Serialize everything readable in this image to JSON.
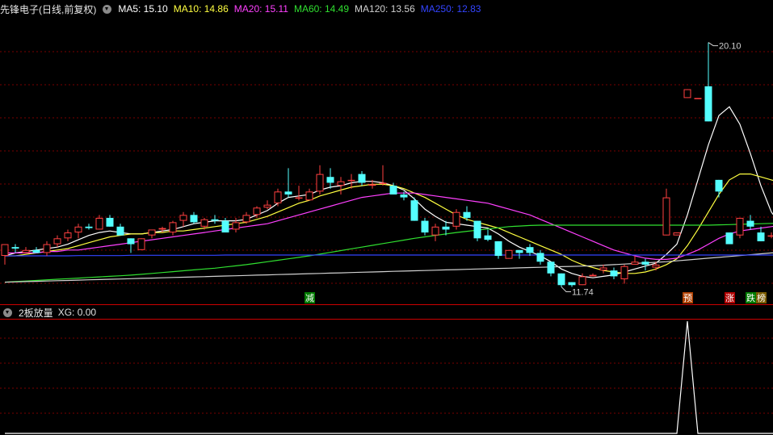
{
  "main_panel": {
    "stock_title": "先锋电子(日线,前复权)",
    "indicators": [
      {
        "label": "MA5:",
        "value": "15.10",
        "color": "#ffffff"
      },
      {
        "label": "MA10:",
        "value": "14.86",
        "color": "#ffff40"
      },
      {
        "label": "MA20:",
        "value": "15.11",
        "color": "#ff40ff"
      },
      {
        "label": "MA60:",
        "value": "14.49",
        "color": "#30e030"
      },
      {
        "label": "MA120:",
        "value": "13.56",
        "color": "#d0d0d0"
      },
      {
        "label": "MA250:",
        "value": "12.83",
        "color": "#3344ff"
      }
    ]
  },
  "sub_panel": {
    "indicator_name": "2板放量",
    "indicators": [
      {
        "label": "XG:",
        "value": "0.00",
        "color": "#e0e0e0"
      }
    ]
  },
  "colors": {
    "up": "#ff4040",
    "down": "#54ffff",
    "grid": "#7a0000",
    "border": "#cc0000",
    "ma5": "#ffffff",
    "ma10": "#ffff40",
    "ma20": "#ff40ff",
    "ma60": "#30e030",
    "ma120": "#d0d0d0",
    "ma250": "#3344ff"
  },
  "chart_data": [
    {
      "type": "candlestick",
      "title": "先锋电子(日线,前复权)",
      "ylim": [
        11.2,
        21.0
      ],
      "ohlc": [
        [
          12.8,
          13.2,
          12.5,
          13.2
        ],
        [
          13.1,
          13.2,
          12.9,
          13.05
        ],
        [
          12.9,
          13.1,
          12.9,
          13.0
        ],
        [
          13.0,
          13.1,
          12.9,
          12.9
        ],
        [
          12.9,
          13.3,
          12.8,
          13.2
        ],
        [
          13.2,
          13.5,
          13.1,
          13.4
        ],
        [
          13.4,
          13.7,
          13.3,
          13.6
        ],
        [
          13.6,
          13.9,
          13.4,
          13.8
        ],
        [
          13.8,
          13.9,
          13.7,
          13.75
        ],
        [
          13.7,
          14.2,
          13.7,
          14.1
        ],
        [
          14.1,
          14.2,
          13.8,
          13.8
        ],
        [
          13.8,
          13.9,
          13.5,
          13.5
        ],
        [
          13.4,
          13.4,
          12.9,
          13.2
        ],
        [
          13.0,
          13.4,
          13.0,
          13.4
        ],
        [
          13.5,
          13.7,
          13.4,
          13.7
        ],
        [
          13.7,
          13.8,
          13.6,
          13.75
        ],
        [
          13.6,
          14.0,
          13.5,
          13.95
        ],
        [
          14.0,
          14.3,
          13.8,
          14.2
        ],
        [
          14.2,
          14.3,
          13.9,
          13.95
        ],
        [
          13.8,
          14.1,
          13.7,
          14.05
        ],
        [
          14.05,
          14.2,
          13.9,
          14.0
        ],
        [
          14.0,
          14.1,
          13.6,
          13.6
        ],
        [
          13.7,
          14.1,
          13.6,
          13.95
        ],
        [
          13.95,
          14.3,
          13.9,
          14.2
        ],
        [
          14.2,
          14.5,
          14.1,
          14.45
        ],
        [
          14.45,
          14.7,
          14.4,
          14.55
        ],
        [
          14.6,
          15.1,
          14.5,
          15.0
        ],
        [
          15.0,
          15.8,
          14.8,
          14.9
        ],
        [
          14.8,
          15.2,
          14.7,
          14.8
        ],
        [
          14.7,
          15.1,
          14.7,
          15.0
        ],
        [
          15.0,
          15.9,
          14.9,
          15.6
        ],
        [
          15.5,
          15.8,
          15.1,
          15.3
        ],
        [
          15.2,
          15.5,
          14.9,
          15.35
        ],
        [
          15.4,
          15.6,
          15.1,
          15.4
        ],
        [
          15.6,
          15.7,
          15.2,
          15.3
        ],
        [
          15.2,
          15.4,
          15.1,
          15.25
        ],
        [
          15.3,
          15.9,
          15.2,
          15.3
        ],
        [
          15.2,
          15.3,
          14.9,
          14.9
        ],
        [
          14.9,
          15.0,
          14.7,
          14.8
        ],
        [
          14.7,
          14.8,
          14.0,
          14.0
        ],
        [
          14.0,
          14.1,
          13.5,
          13.6
        ],
        [
          13.5,
          13.9,
          13.3,
          13.8
        ],
        [
          13.8,
          14.0,
          13.5,
          13.7
        ],
        [
          13.8,
          14.4,
          13.7,
          14.3
        ],
        [
          14.3,
          14.5,
          14.0,
          14.1
        ],
        [
          14.0,
          14.0,
          13.3,
          13.4
        ],
        [
          13.5,
          13.7,
          13.3,
          13.35
        ],
        [
          13.3,
          13.3,
          12.7,
          12.8
        ],
        [
          12.7,
          13.0,
          12.7,
          13.0
        ],
        [
          13.0,
          13.0,
          12.7,
          12.9
        ],
        [
          13.1,
          13.2,
          12.8,
          12.9
        ],
        [
          12.9,
          13.0,
          12.5,
          12.6
        ],
        [
          12.6,
          12.6,
          12.1,
          12.2
        ],
        [
          12.2,
          12.2,
          11.74,
          11.8
        ],
        [
          11.9,
          11.9,
          11.74,
          11.8
        ],
        [
          11.8,
          12.2,
          11.8,
          12.1
        ],
        [
          12.1,
          12.2,
          12.1,
          12.15
        ],
        [
          12.3,
          12.5,
          12.2,
          12.4
        ],
        [
          12.3,
          12.4,
          12.0,
          12.1
        ],
        [
          12.0,
          12.5,
          11.85,
          12.45
        ],
        [
          12.5,
          12.8,
          12.5,
          12.6
        ],
        [
          12.6,
          12.7,
          12.3,
          12.5
        ],
        [
          12.4,
          12.6,
          12.3,
          12.5
        ],
        [
          13.5,
          15.1,
          13.5,
          14.8
        ],
        [
          13.5,
          13.6,
          13.5,
          13.6
        ],
        [
          18.2,
          18.5,
          18.2,
          18.5
        ],
        [
          18.2,
          18.2,
          18.2,
          18.2
        ],
        [
          18.6,
          20.1,
          17.4,
          17.4
        ],
        [
          15.4,
          15.4,
          14.8,
          15.0
        ],
        [
          13.6,
          13.6,
          13.2,
          13.2
        ],
        [
          13.5,
          14.1,
          13.4,
          14.1
        ],
        [
          14.0,
          14.2,
          13.7,
          13.8
        ],
        [
          13.6,
          13.8,
          13.3,
          13.3
        ],
        [
          13.5,
          13.6,
          13.4,
          13.5
        ],
        [
          13.6,
          13.9,
          13.5,
          13.8
        ],
        [
          13.8,
          14.0,
          13.7,
          13.9
        ],
        [
          13.8,
          14.1,
          13.8,
          14.05
        ],
        [
          13.9,
          14.3,
          13.9,
          14.25
        ],
        [
          14.0,
          14.4,
          13.9,
          14.2
        ]
      ],
      "max_label": "20.10",
      "min_label": "11.74",
      "signals": [
        {
          "bar": 29,
          "text": "减",
          "bg": "#007a00"
        },
        {
          "bar": 65,
          "text": "预",
          "bg": "#b04000"
        },
        {
          "bar": 69,
          "text": "涨",
          "bg": "#b00000"
        },
        {
          "bar": 71,
          "text": "跌",
          "bg": "#007a00"
        },
        {
          "bar": 72,
          "text": "榜",
          "bg": "#7a5a00"
        }
      ],
      "ma_series": [
        {
          "name": "MA5",
          "color": "#ffffff",
          "values": [
            12.8,
            12.9,
            12.95,
            13.0,
            13.05,
            13.1,
            13.2,
            13.35,
            13.5,
            13.6,
            13.65,
            13.6,
            13.55,
            13.55,
            13.6,
            13.65,
            13.7,
            13.8,
            13.9,
            13.95,
            14.0,
            14.0,
            14.0,
            14.05,
            14.2,
            14.35,
            14.6,
            14.8,
            14.85,
            14.9,
            15.05,
            15.15,
            15.2,
            15.3,
            15.35,
            15.35,
            15.3,
            15.2,
            15.05,
            14.75,
            14.4,
            14.15,
            13.95,
            13.9,
            13.85,
            13.8,
            13.75,
            13.55,
            13.3,
            13.1,
            12.95,
            12.8,
            12.6,
            12.35,
            12.2,
            12.1,
            12.05,
            12.1,
            12.15,
            12.25,
            12.35,
            12.45,
            12.55,
            12.85,
            13.2,
            14.2,
            15.4,
            16.6,
            17.6,
            17.9,
            17.3,
            16.3,
            15.2,
            14.3,
            13.8,
            13.6,
            13.65,
            13.75,
            13.9,
            14.0
          ]
        },
        {
          "name": "MA10",
          "color": "#ffff40",
          "values": [
            12.8,
            12.8,
            12.85,
            12.9,
            12.95,
            13.0,
            13.05,
            13.15,
            13.25,
            13.35,
            13.45,
            13.5,
            13.55,
            13.55,
            13.6,
            13.6,
            13.65,
            13.65,
            13.7,
            13.75,
            13.8,
            13.85,
            13.9,
            13.95,
            14.05,
            14.15,
            14.3,
            14.45,
            14.6,
            14.7,
            14.85,
            14.95,
            15.05,
            15.15,
            15.2,
            15.25,
            15.25,
            15.2,
            15.1,
            14.95,
            14.8,
            14.6,
            14.4,
            14.2,
            14.05,
            13.95,
            13.85,
            13.75,
            13.6,
            13.45,
            13.3,
            13.15,
            13.0,
            12.85,
            12.65,
            12.5,
            12.4,
            12.3,
            12.25,
            12.2,
            12.2,
            12.25,
            12.35,
            12.5,
            12.7,
            13.15,
            13.7,
            14.3,
            14.9,
            15.4,
            15.6,
            15.6,
            15.5,
            15.4,
            15.3,
            15.2,
            15.15,
            15.1,
            15.1,
            15.1
          ]
        },
        {
          "name": "MA20",
          "color": "#ff40ff",
          "values": [
            12.9,
            12.9,
            12.9,
            12.9,
            12.95,
            12.95,
            13.0,
            13.0,
            13.05,
            13.1,
            13.15,
            13.2,
            13.25,
            13.3,
            13.35,
            13.4,
            13.45,
            13.5,
            13.55,
            13.6,
            13.65,
            13.7,
            13.75,
            13.8,
            13.85,
            13.9,
            14.0,
            14.1,
            14.2,
            14.3,
            14.4,
            14.5,
            14.6,
            14.7,
            14.8,
            14.85,
            14.9,
            14.95,
            14.95,
            14.95,
            14.9,
            14.85,
            14.8,
            14.75,
            14.7,
            14.65,
            14.6,
            14.5,
            14.4,
            14.3,
            14.2,
            14.05,
            13.9,
            13.75,
            13.6,
            13.45,
            13.3,
            13.15,
            13.0,
            12.9,
            12.8,
            12.72,
            12.68,
            12.68,
            12.72,
            12.85,
            13.0,
            13.2,
            13.4,
            13.55,
            13.65,
            13.7,
            13.75,
            13.8,
            13.85,
            13.9,
            13.95,
            14.0,
            14.05,
            14.1
          ]
        },
        {
          "name": "MA60",
          "color": "#30e030",
          "values": [
            11.9,
            11.92,
            11.94,
            11.96,
            11.98,
            12.0,
            12.02,
            12.04,
            12.06,
            12.08,
            12.1,
            12.12,
            12.14,
            12.17,
            12.2,
            12.23,
            12.26,
            12.29,
            12.32,
            12.35,
            12.38,
            12.42,
            12.46,
            12.5,
            12.55,
            12.6,
            12.65,
            12.7,
            12.75,
            12.8,
            12.86,
            12.92,
            12.98,
            13.04,
            13.1,
            13.16,
            13.22,
            13.28,
            13.34,
            13.4,
            13.45,
            13.5,
            13.55,
            13.6,
            13.64,
            13.68,
            13.72,
            13.76,
            13.8,
            13.82,
            13.84,
            13.85,
            13.85,
            13.85,
            13.85,
            13.85,
            13.85,
            13.85,
            13.85,
            13.85,
            13.85,
            13.85,
            13.85,
            13.85,
            13.85,
            13.85,
            13.85,
            13.85,
            13.86,
            13.87,
            13.88,
            13.89,
            13.9,
            13.91,
            13.92,
            13.93,
            13.94,
            13.95,
            13.96,
            13.97
          ]
        },
        {
          "name": "MA120",
          "color": "#d0d0d0",
          "values": [
            11.9,
            11.91,
            11.92,
            11.93,
            11.94,
            11.95,
            11.96,
            11.97,
            11.98,
            11.99,
            12.0,
            12.01,
            12.02,
            12.03,
            12.04,
            12.05,
            12.06,
            12.07,
            12.08,
            12.09,
            12.1,
            12.11,
            12.12,
            12.13,
            12.14,
            12.15,
            12.16,
            12.17,
            12.18,
            12.19,
            12.2,
            12.21,
            12.22,
            12.23,
            12.24,
            12.25,
            12.26,
            12.27,
            12.28,
            12.29,
            12.3,
            12.31,
            12.32,
            12.33,
            12.34,
            12.35,
            12.36,
            12.37,
            12.38,
            12.39,
            12.4,
            12.41,
            12.42,
            12.43,
            12.44,
            12.45,
            12.46,
            12.48,
            12.5,
            12.52,
            12.54,
            12.56,
            12.58,
            12.6,
            12.63,
            12.66,
            12.69,
            12.72,
            12.75,
            12.78,
            12.81,
            12.84,
            12.87,
            12.9,
            12.93,
            12.96,
            12.99,
            13.02,
            13.05,
            13.08
          ]
        },
        {
          "name": "MA250",
          "color": "#3344ff",
          "values": [
            12.8,
            12.8,
            12.8,
            12.8,
            12.8,
            12.8,
            12.8,
            12.81,
            12.81,
            12.81,
            12.81,
            12.81,
            12.82,
            12.82,
            12.82,
            12.82,
            12.82,
            12.82,
            12.82,
            12.82,
            12.82,
            12.83,
            12.83,
            12.83,
            12.83,
            12.83,
            12.83,
            12.83,
            12.83,
            12.83,
            12.83,
            12.83,
            12.83,
            12.83,
            12.83,
            12.83,
            12.83,
            12.83,
            12.83,
            12.83,
            12.83,
            12.83,
            12.83,
            12.83,
            12.83,
            12.83,
            12.83,
            12.83,
            12.83,
            12.83,
            12.83,
            12.83,
            12.83,
            12.83,
            12.83,
            12.83,
            12.83,
            12.83,
            12.83,
            12.83,
            12.83,
            12.83,
            12.83,
            12.83,
            12.83,
            12.83,
            12.83,
            12.83,
            12.83,
            12.83,
            12.83,
            12.83,
            12.83,
            12.83,
            12.83,
            12.83,
            12.83,
            12.83,
            12.83,
            12.83
          ]
        }
      ]
    },
    {
      "type": "line",
      "title": "2板放量",
      "ylim": [
        0,
        1
      ],
      "series": [
        {
          "name": "XG",
          "values": [
            0,
            0,
            0,
            0,
            0,
            0,
            0,
            0,
            0,
            0,
            0,
            0,
            0,
            0,
            0,
            0,
            0,
            0,
            0,
            0,
            0,
            0,
            0,
            0,
            0,
            0,
            0,
            0,
            0,
            0,
            0,
            0,
            0,
            0,
            0,
            0,
            0,
            0,
            0,
            0,
            0,
            0,
            0,
            0,
            0,
            0,
            0,
            0,
            0,
            0,
            0,
            0,
            0,
            0,
            0,
            0,
            0,
            0,
            0,
            0,
            0,
            0,
            0,
            0,
            0,
            1,
            0,
            0,
            0,
            0,
            0,
            0,
            0,
            0,
            0,
            0,
            0,
            0,
            0,
            0
          ]
        }
      ]
    }
  ]
}
